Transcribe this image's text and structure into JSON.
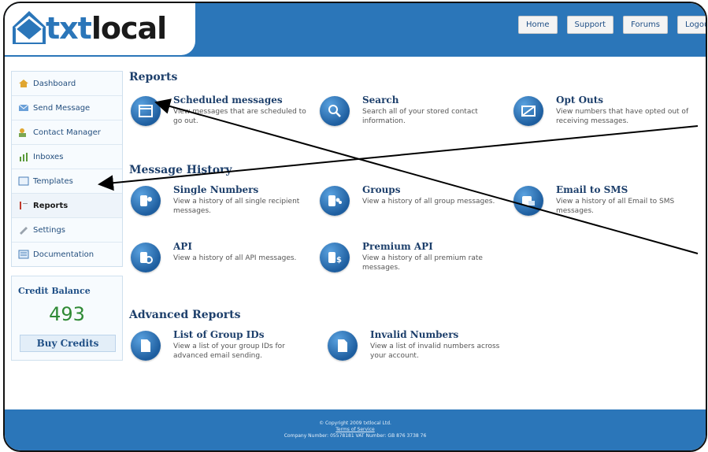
{
  "brand": {
    "logo_part1": "txt",
    "logo_part2": "local"
  },
  "topnav": [
    "Home",
    "Support",
    "Forums",
    "Logout"
  ],
  "sidebar": {
    "items": [
      {
        "label": "Dashboard",
        "icon": "home-icon"
      },
      {
        "label": "Send Message",
        "icon": "send-icon"
      },
      {
        "label": "Contact Manager",
        "icon": "contacts-icon"
      },
      {
        "label": "Inboxes",
        "icon": "inbox-icon"
      },
      {
        "label": "Templates",
        "icon": "template-icon"
      },
      {
        "label": "Reports",
        "icon": "reports-icon",
        "active": true
      },
      {
        "label": "Settings",
        "icon": "settings-icon"
      },
      {
        "label": "Documentation",
        "icon": "documentation-icon"
      }
    ]
  },
  "credit": {
    "title": "Credit Balance",
    "value": "493",
    "button": "Buy Credits"
  },
  "sections": {
    "reports": {
      "title": "Reports",
      "items": [
        {
          "title": "Scheduled messages",
          "desc": "View messages that are scheduled to go out.",
          "icon": "calendar-icon"
        },
        {
          "title": "Search",
          "desc": "Search all of your stored contact information.",
          "icon": "search-icon"
        },
        {
          "title": "Opt Outs",
          "desc": "View numbers that have opted out of receiving messages.",
          "icon": "optout-icon"
        }
      ]
    },
    "history": {
      "title": "Message History",
      "items": [
        {
          "title": "Single Numbers",
          "desc": "View a history of all single recipient messages.",
          "icon": "single-user-icon"
        },
        {
          "title": "Groups",
          "desc": "View a history of all group messages.",
          "icon": "group-icon"
        },
        {
          "title": "Email to SMS",
          "desc": "View a history of all Email to SMS messages.",
          "icon": "email-icon"
        },
        {
          "title": "API",
          "desc": "View a history of all API messages.",
          "icon": "api-icon"
        },
        {
          "title": "Premium API",
          "desc": "View a history of all premium rate messages.",
          "icon": "premium-icon"
        }
      ]
    },
    "advanced": {
      "title": "Advanced Reports",
      "items": [
        {
          "title": "List of Group IDs",
          "desc": "View a list of your group IDs for advanced email sending.",
          "icon": "document-icon"
        },
        {
          "title": "Invalid Numbers",
          "desc": "View a list of invalid numbers across your account.",
          "icon": "document-icon"
        }
      ]
    }
  },
  "footer": {
    "copyright": "© Copyright 2009 txtlocal Ltd.",
    "terms": "Terms of Service",
    "company": "Company Number: 05578181  VAT Number: GB 876 3738 76"
  },
  "colors": {
    "brand_blue": "#2b76b9",
    "credit_green": "#2f8a35"
  }
}
